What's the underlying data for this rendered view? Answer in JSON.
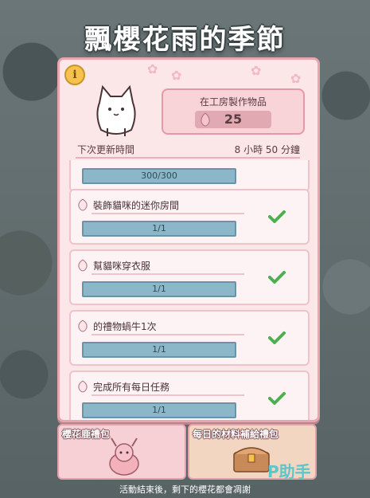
{
  "title": "飄櫻花雨的季節",
  "info_label": "i",
  "craft": {
    "label": "在工房製作物品",
    "count": "25"
  },
  "refresh": {
    "label": "下次更新時間",
    "value": "8 小時 50 分鐘"
  },
  "partial_bar": "300/300",
  "tasks": [
    {
      "name": "裝飾貓咪的迷你房間",
      "progress": "1/1"
    },
    {
      "name": "幫貓咪穿衣服",
      "progress": "1/1"
    },
    {
      "name": "的禮物蝸牛1次",
      "progress": "1/1"
    },
    {
      "name": "完成所有每日任務",
      "progress": "1/1"
    }
  ],
  "bundles": [
    {
      "label": "櫻花鹿禮包"
    },
    {
      "label": "每日的材料補給禮包"
    }
  ],
  "footer": "活動結束後，剩下的櫻花都會凋謝",
  "watermark": "P助手",
  "colors": {
    "panel": "#fbe6e8",
    "border": "#e7a7b1",
    "bar": "#8bb7c8",
    "check": "#4caf50"
  }
}
